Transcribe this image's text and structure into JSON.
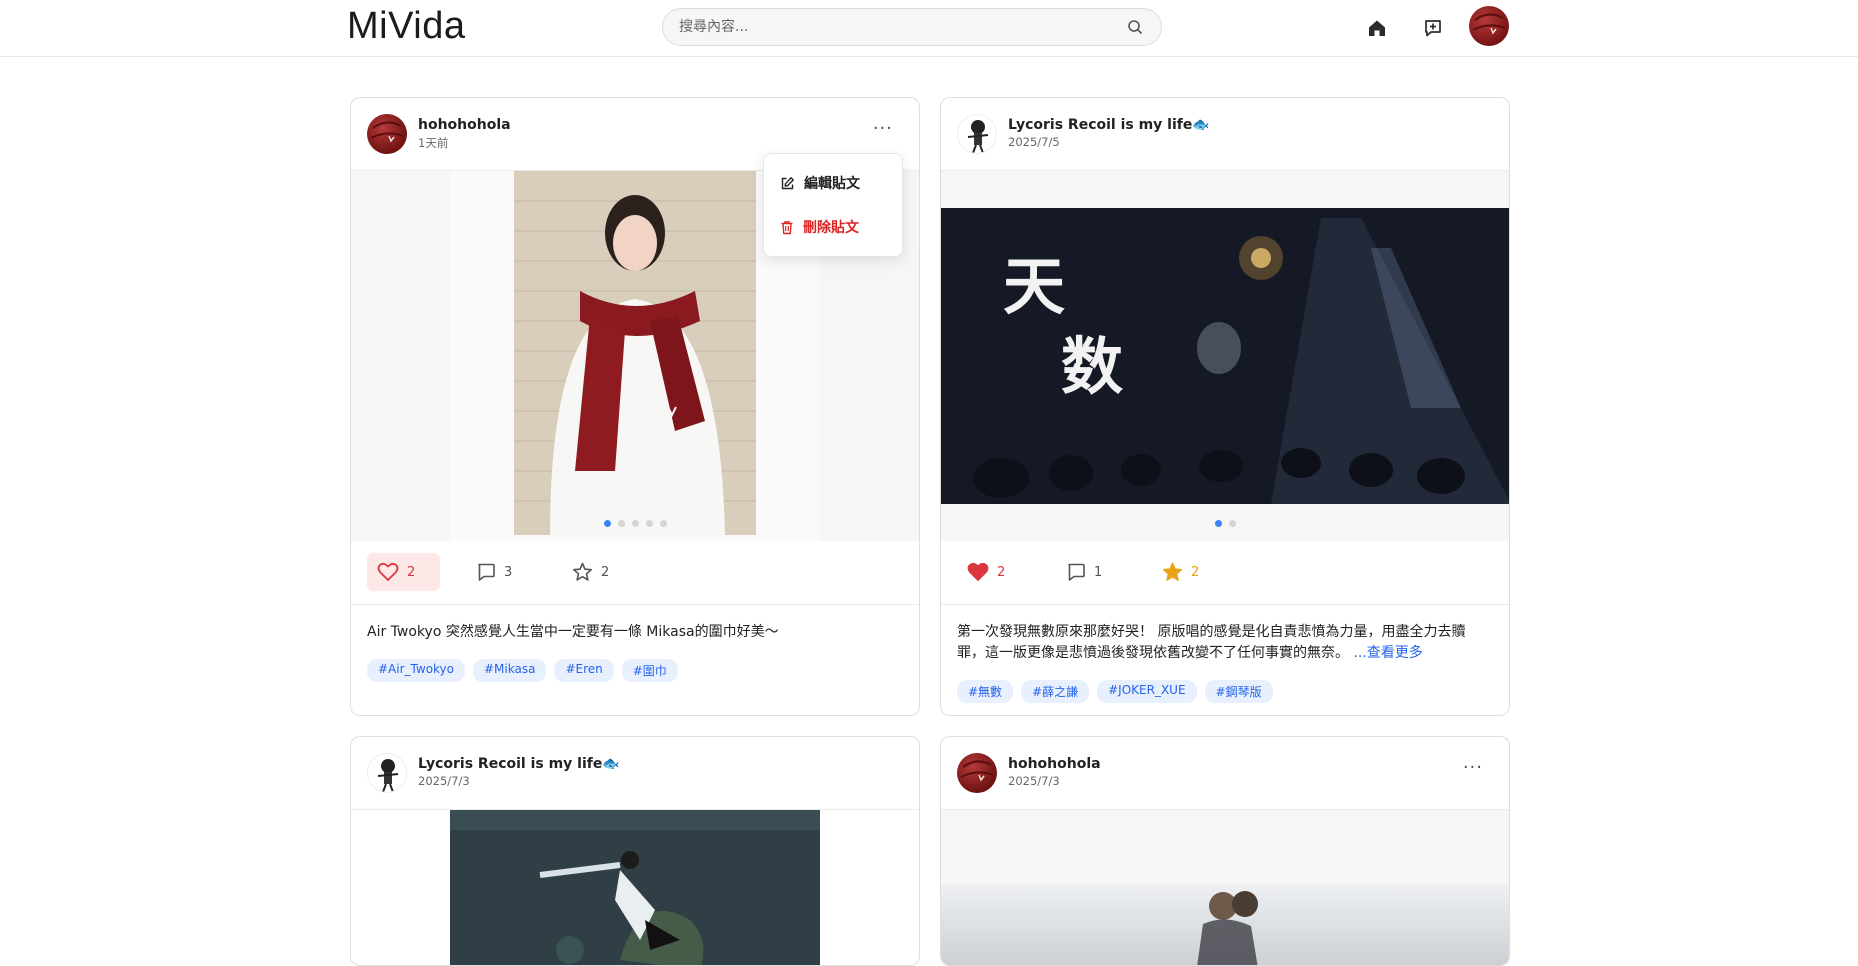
{
  "header": {
    "logo": "MiVida",
    "search_placeholder": "搜尋內容...",
    "icons": [
      "home-icon",
      "create-post-icon",
      "avatar"
    ]
  },
  "posts": [
    {
      "user": "hohohohola",
      "time": "1天前",
      "media_dots": 5,
      "media_active": 0,
      "likes": "2",
      "comments": "3",
      "favorites": "2",
      "liked": true,
      "caption": "Air Twokyo 突然感覺人生當中一定要有一條 Mikasa的圍巾好美～",
      "tags": [
        "#Air_Twokyo",
        "#Mikasa",
        "#Eren",
        "#圍巾"
      ]
    },
    {
      "user": "Lycoris Recoil is my life🐟",
      "time": "2025/7/5",
      "media_dots": 2,
      "media_active": 0,
      "likes": "2",
      "comments": "1",
      "favorites": "2",
      "liked": true,
      "caption": "第一次發現無數原來那麼好哭！ 原版唱的感覺是化自責悲憤為力量，用盡全力去贖罪，這一版更像是悲憤過後發現依舊改變不了任何事實的無奈。",
      "see_more": "...查看更多",
      "tags": [
        "#無數",
        "#薛之謙",
        "#JOKER_XUE",
        "#鋼琴版"
      ]
    },
    {
      "user": "Lycoris Recoil is my life🐟",
      "time": "2025/7/3"
    },
    {
      "user": "hohohohola",
      "time": "2025/7/3"
    }
  ],
  "post_menu": {
    "edit": "編輯貼文",
    "delete": "刪除貼文"
  },
  "colors": {
    "accent": "#2563eb",
    "like": "#d9363e",
    "star": "#e8a317",
    "danger": "#dc2626"
  }
}
